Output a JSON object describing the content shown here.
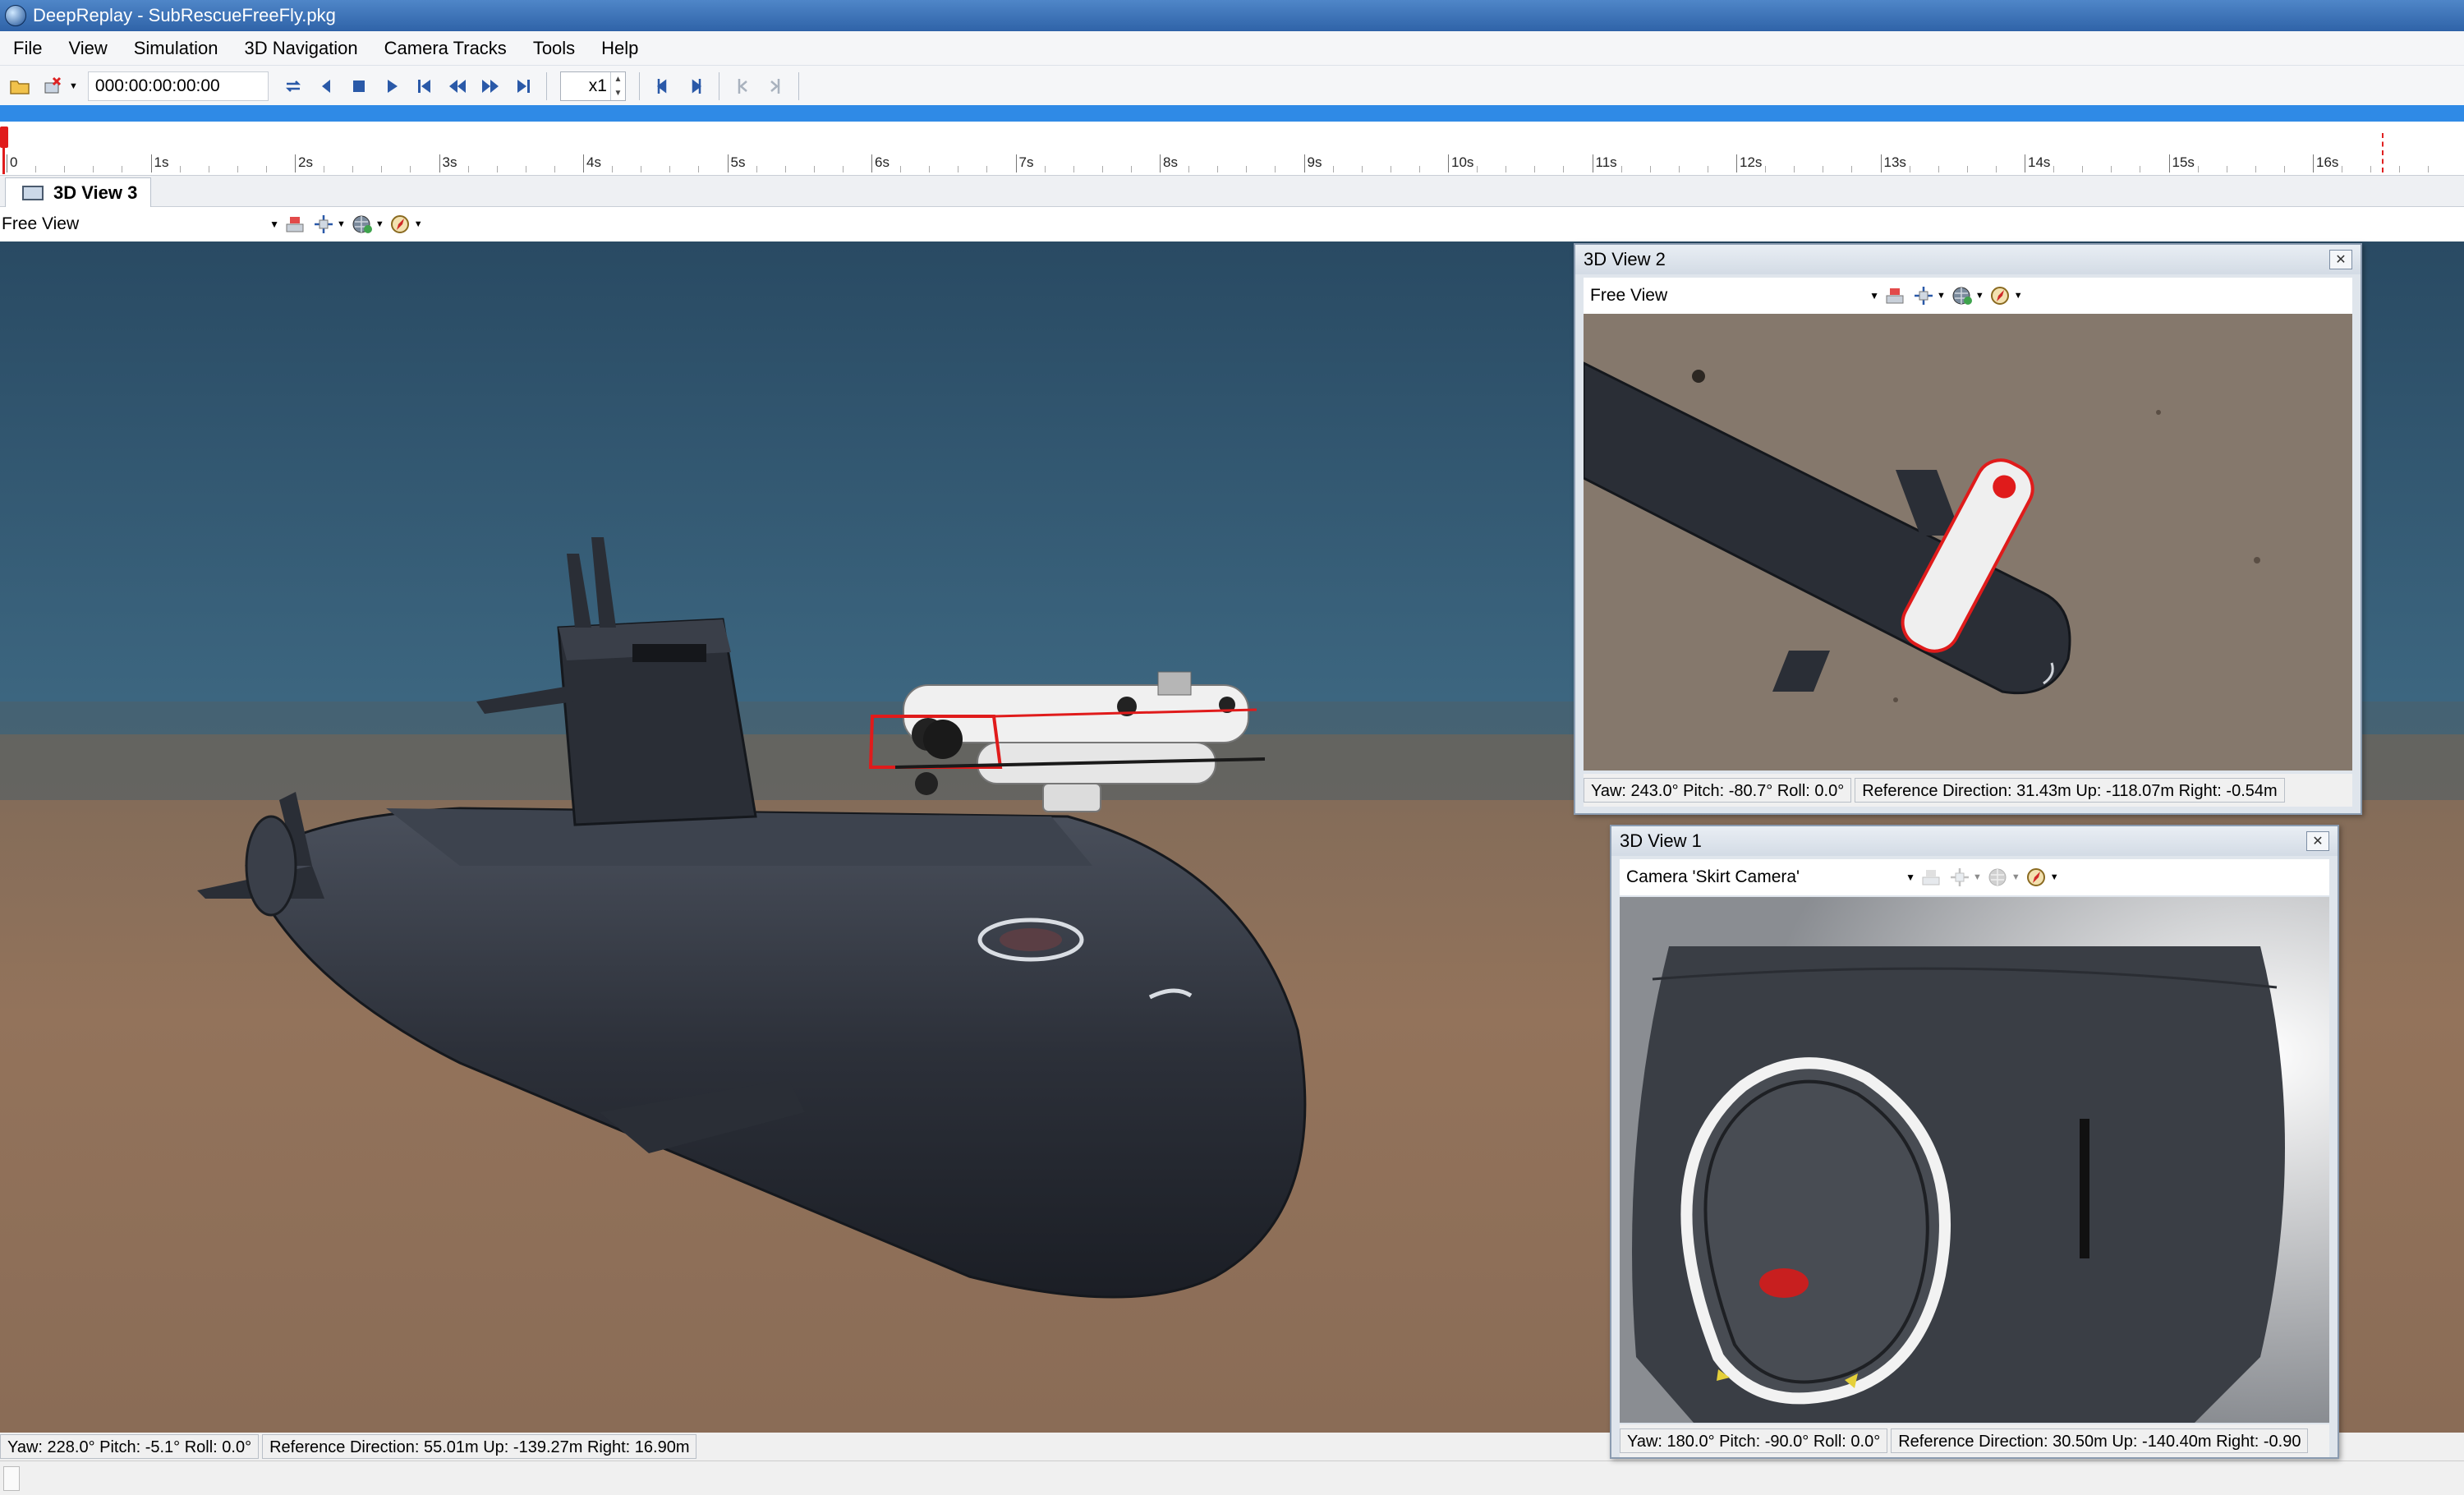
{
  "window": {
    "app_name": "DeepReplay",
    "file_name": "SubRescueFreeFly.pkg"
  },
  "menu": [
    "File",
    "View",
    "Simulation",
    "3D Navigation",
    "Camera Tracks",
    "Tools",
    "Help"
  ],
  "toolbar": {
    "timecode": "000:00:00:00:00",
    "speed": "x1",
    "icons": [
      "open-folder-icon",
      "close-file-icon",
      "loop-icon",
      "step-back-icon",
      "stop-icon",
      "play-icon",
      "go-start-icon",
      "rewind-icon",
      "fast-forward-icon",
      "go-end-icon",
      "mark-in-icon",
      "mark-out-icon",
      "prev-mark-icon",
      "next-mark-icon"
    ]
  },
  "timeline": {
    "labels": [
      "0",
      "1s",
      "2s",
      "3s",
      "4s",
      "5s",
      "6s",
      "7s",
      "8s",
      "9s",
      "10s",
      "11s",
      "12s",
      "13s",
      "14s",
      "15s",
      "16s"
    ],
    "playhead_seconds": 0
  },
  "tabs": [
    {
      "label": "3D View 3"
    }
  ],
  "views": {
    "view3": {
      "camera": "Free View",
      "status": [
        "Yaw: 228.0°   Pitch: -5.1°   Roll: 0.0°",
        "Reference Direction: 55.01m   Up: -139.27m   Right: 16.90m"
      ]
    },
    "view2": {
      "title": "3D View 2",
      "camera": "Free View",
      "status": [
        "Yaw: 243.0°   Pitch: -80.7°   Roll: 0.0°",
        "Reference Direction: 31.43m   Up: -118.07m   Right: -0.54m"
      ]
    },
    "view1": {
      "title": "3D View 1",
      "camera": "Camera 'Skirt Camera'",
      "status": [
        "Yaw: 180.0°   Pitch: -90.0°   Roll: 0.0°",
        "Reference Direction: 30.50m   Up: -140.40m   Right: -0.90"
      ]
    }
  },
  "colors": {
    "title_bar": "#3b72b8",
    "progress": "#2f8ae6",
    "selection": "#e01b1b",
    "seabed": "#8f6f58",
    "water": "#2f4f66"
  }
}
